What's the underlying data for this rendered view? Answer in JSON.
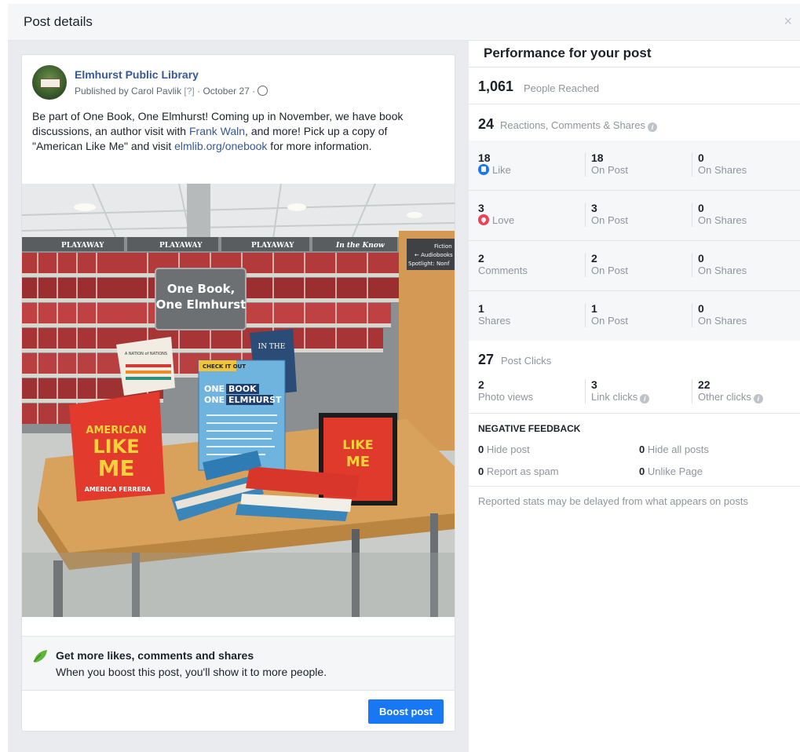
{
  "header": {
    "title": "Post details",
    "close_glyph": "×"
  },
  "post": {
    "page_name": "Elmhurst Public Library",
    "published_by": "Published by Carol Pavlik",
    "help_marker": "[?]",
    "date": "· October 27 ·",
    "text_part1": "Be part of One Book, One Elmhurst! Coming up in November, we have book discussions, an author visit with ",
    "text_link1": "Frank Waln",
    "text_part2": ", and more! Pick up a copy of \"American Like Me\" and visit ",
    "text_link2": "elmlib.org/onebook",
    "text_part3": " for more information.",
    "photo": {
      "sign_line1": "One Book,",
      "sign_line2": "One Elmhurst",
      "shelf_labels": [
        "PLAYAWAY",
        "PLAYAWAY",
        "PLAYAWAY",
        "In the Know"
      ],
      "right_sign_lines": [
        "Fiction",
        "← Audiobooks",
        "Spotlight: Nonf"
      ],
      "flyer_tag": "CHECK IT OUT",
      "flyer_title1": "ONE",
      "flyer_title1b": "BOOK",
      "flyer_title2": "ONE",
      "flyer_title2b": "ELMHURST",
      "book_title_a": "AMERICAN",
      "book_title_b": "LIKE",
      "book_title_c": "ME",
      "book_author": "AMERICA FERRERA",
      "nation_book": "A NATION of NATIONS",
      "in_the_book": "IN THE"
    }
  },
  "boost": {
    "tip_title": "Get more likes, comments and shares",
    "tip_body": "When you boost this post, you'll show it to more people.",
    "button_label": "Boost post"
  },
  "performance": {
    "title": "Performance for your post",
    "reached_value": "1,061",
    "reached_label": "People Reached",
    "rcs_value": "24",
    "rcs_label": "Reactions, Comments & Shares",
    "info_glyph": "i",
    "rows": [
      {
        "v1": "18",
        "l1": "Like",
        "v2": "18",
        "l2": "On Post",
        "v3": "0",
        "l3": "On Shares"
      },
      {
        "v1": "3",
        "l1": "Love",
        "v2": "3",
        "l2": "On Post",
        "v3": "0",
        "l3": "On Shares"
      },
      {
        "v1": "2",
        "l1": "Comments",
        "v2": "2",
        "l2": "On Post",
        "v3": "0",
        "l3": "On Shares"
      },
      {
        "v1": "1",
        "l1": "Shares",
        "v2": "1",
        "l2": "On Post",
        "v3": "0",
        "l3": "On Shares"
      }
    ],
    "clicks_value": "27",
    "clicks_label": "Post Clicks",
    "click_breakdown": [
      {
        "value": "2",
        "label": "Photo views"
      },
      {
        "value": "3",
        "label": "Link clicks"
      },
      {
        "value": "22",
        "label": "Other clicks"
      }
    ],
    "negative_title": "NEGATIVE FEEDBACK",
    "negative": [
      {
        "value": "0",
        "label": "Hide post"
      },
      {
        "value": "0",
        "label": "Hide all posts"
      },
      {
        "value": "0",
        "label": "Report as spam"
      },
      {
        "value": "0",
        "label": "Unlike Page"
      }
    ],
    "note": "Reported stats may be delayed from what appears on posts"
  },
  "colors": {
    "accent": "#1877f2",
    "link": "#365899",
    "love": "#f0405a",
    "panel_bg": "#e9ebee"
  }
}
